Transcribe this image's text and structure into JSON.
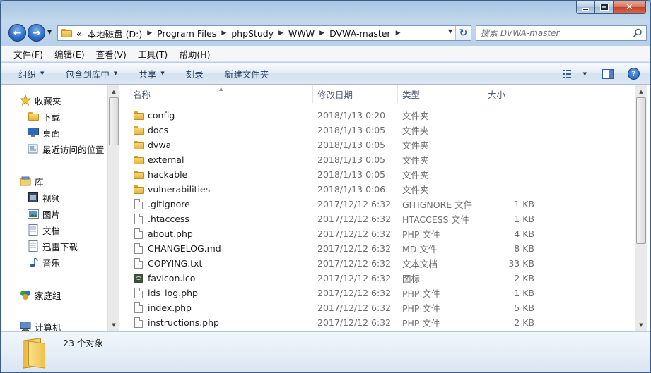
{
  "window": {
    "caption": {
      "min": "",
      "max": "",
      "close": "✕"
    }
  },
  "nav": {
    "back": "←",
    "forward": "→",
    "breadcrumb": [
      "«",
      "本地磁盘 (D:)",
      "Program Files",
      "phpStudy",
      "WWW",
      "DVWA-master"
    ],
    "search_placeholder": "搜索 DVWA-master"
  },
  "menu": [
    "文件(F)",
    "编辑(E)",
    "查看(V)",
    "工具(T)",
    "帮助(H)"
  ],
  "commands": [
    {
      "label": "组织",
      "dropdown": true
    },
    {
      "label": "包含到库中",
      "dropdown": true
    },
    {
      "label": "共享",
      "dropdown": true
    },
    {
      "label": "刻录",
      "dropdown": false
    },
    {
      "label": "新建文件夹",
      "dropdown": false
    }
  ],
  "help_label": "?",
  "sidebar": {
    "favorites": {
      "label": "收藏夹",
      "items": [
        "下载",
        "桌面",
        "最近访问的位置"
      ]
    },
    "libraries": {
      "label": "库",
      "items": [
        "视频",
        "图片",
        "文档",
        "迅雷下载",
        "音乐"
      ]
    },
    "homegroup": "家庭组",
    "computer": "计算机"
  },
  "columns": {
    "name": "名称",
    "date": "修改日期",
    "type": "类型",
    "size": "大小"
  },
  "files": [
    {
      "name": "config",
      "date": "2018/1/13 0:20",
      "type": "文件夹",
      "size": "",
      "kind": "folder"
    },
    {
      "name": "docs",
      "date": "2018/1/13 0:05",
      "type": "文件夹",
      "size": "",
      "kind": "folder"
    },
    {
      "name": "dvwa",
      "date": "2018/1/13 0:05",
      "type": "文件夹",
      "size": "",
      "kind": "folder"
    },
    {
      "name": "external",
      "date": "2018/1/13 0:05",
      "type": "文件夹",
      "size": "",
      "kind": "folder"
    },
    {
      "name": "hackable",
      "date": "2018/1/13 0:05",
      "type": "文件夹",
      "size": "",
      "kind": "folder"
    },
    {
      "name": "vulnerabilities",
      "date": "2018/1/13 0:06",
      "type": "文件夹",
      "size": "",
      "kind": "folder"
    },
    {
      "name": ".gitignore",
      "date": "2017/12/12 6:32",
      "type": "GITIGNORE 文件",
      "size": "1 KB",
      "kind": "file"
    },
    {
      "name": ".htaccess",
      "date": "2017/12/12 6:32",
      "type": "HTACCESS 文件",
      "size": "1 KB",
      "kind": "file"
    },
    {
      "name": "about.php",
      "date": "2017/12/12 6:32",
      "type": "PHP 文件",
      "size": "4 KB",
      "kind": "file"
    },
    {
      "name": "CHANGELOG.md",
      "date": "2017/12/12 6:32",
      "type": "MD 文件",
      "size": "8 KB",
      "kind": "file"
    },
    {
      "name": "COPYING.txt",
      "date": "2017/12/12 6:32",
      "type": "文本文档",
      "size": "33 KB",
      "kind": "file"
    },
    {
      "name": "favicon.ico",
      "date": "2017/12/12 6:32",
      "type": "图标",
      "size": "2 KB",
      "kind": "ico"
    },
    {
      "name": "ids_log.php",
      "date": "2017/12/12 6:32",
      "type": "PHP 文件",
      "size": "1 KB",
      "kind": "file"
    },
    {
      "name": "index.php",
      "date": "2017/12/12 6:32",
      "type": "PHP 文件",
      "size": "5 KB",
      "kind": "file"
    },
    {
      "name": "instructions.php",
      "date": "2017/12/12 6:32",
      "type": "PHP 文件",
      "size": "2 KB",
      "kind": "file"
    }
  ],
  "status": {
    "count": "23 个对象"
  }
}
